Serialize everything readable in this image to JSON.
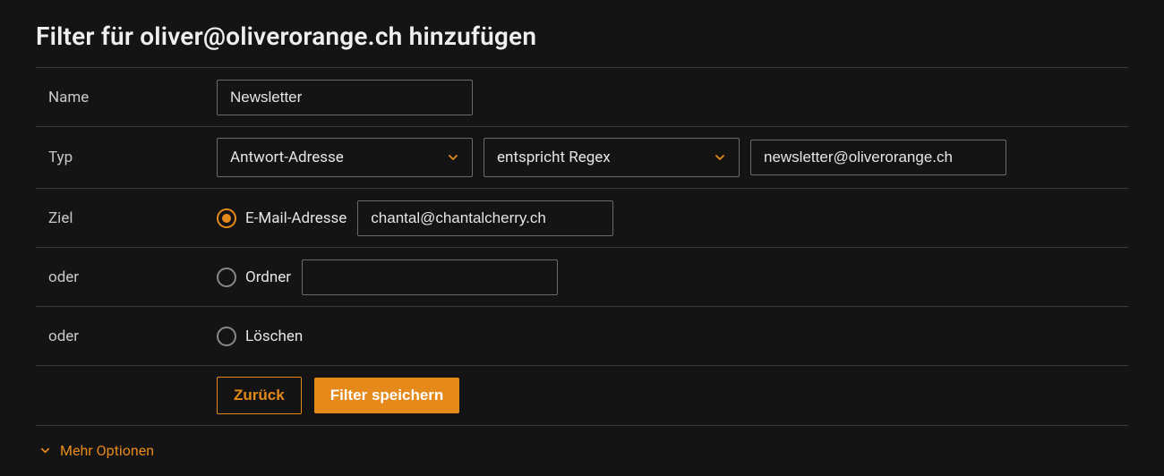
{
  "title": "Filter für oliver@oliverorange.ch hinzufügen",
  "rows": {
    "name": {
      "label": "Name",
      "value": "Newsletter"
    },
    "type": {
      "label": "Typ",
      "field_select": "Antwort-Adresse",
      "match_select": "entspricht Regex",
      "value": "newsletter@oliverorange.ch"
    },
    "target": {
      "label": "Ziel",
      "email_radio_label": "E-Mail-Adresse",
      "email_value": "chantal@chantalcherry.ch",
      "email_checked": true
    },
    "or1": {
      "label": "oder",
      "folder_radio_label": "Ordner",
      "folder_value": "",
      "folder_checked": false
    },
    "or2": {
      "label": "oder",
      "delete_radio_label": "Löschen",
      "delete_checked": false
    }
  },
  "buttons": {
    "back": "Zurück",
    "save": "Filter speichern"
  },
  "more_options": "Mehr Optionen"
}
